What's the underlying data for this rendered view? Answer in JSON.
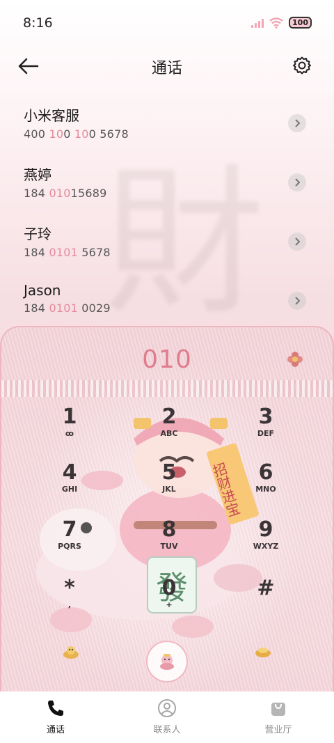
{
  "status_bar": {
    "time": "8:16",
    "battery": "100"
  },
  "header": {
    "title": "通话"
  },
  "contacts": [
    {
      "name": "小米客服",
      "number_parts": [
        "400 ",
        "10",
        "0 ",
        "10",
        "0 5678"
      ]
    },
    {
      "name": "燕婷",
      "number_parts": [
        "184 ",
        "010",
        "15689",
        "",
        ""
      ]
    },
    {
      "name": "子玲",
      "number_parts": [
        "184 ",
        "0101",
        " 5678",
        "",
        ""
      ]
    },
    {
      "name": "Jason",
      "number_parts": [
        "184 ",
        "0101",
        " 0029",
        "",
        ""
      ]
    }
  ],
  "dialer": {
    "display": "010",
    "keys": [
      {
        "digit": "1",
        "letters": "ꝏ"
      },
      {
        "digit": "2",
        "letters": "ABC"
      },
      {
        "digit": "3",
        "letters": "DEF"
      },
      {
        "digit": "4",
        "letters": "GHI"
      },
      {
        "digit": "5",
        "letters": "JKL"
      },
      {
        "digit": "6",
        "letters": "MNO"
      },
      {
        "digit": "7",
        "letters": "PQRS"
      },
      {
        "digit": "8",
        "letters": "TUV"
      },
      {
        "digit": "9",
        "letters": "WXYZ"
      },
      {
        "digit": "*",
        "letters": ","
      },
      {
        "digit": "0",
        "letters": "+"
      },
      {
        "digit": "#",
        "letters": ""
      }
    ],
    "banner_text": "招财进宝",
    "tile_text": "發"
  },
  "bottom_nav": [
    {
      "label": "通话",
      "icon": "phone-icon",
      "active": true
    },
    {
      "label": "联系人",
      "icon": "contacts-icon",
      "active": false
    },
    {
      "label": "营业厅",
      "icon": "bag-icon",
      "active": false
    }
  ],
  "colors": {
    "accent": "#e07d8d",
    "highlight": "#e48a98",
    "border": "#eeb6c1"
  }
}
